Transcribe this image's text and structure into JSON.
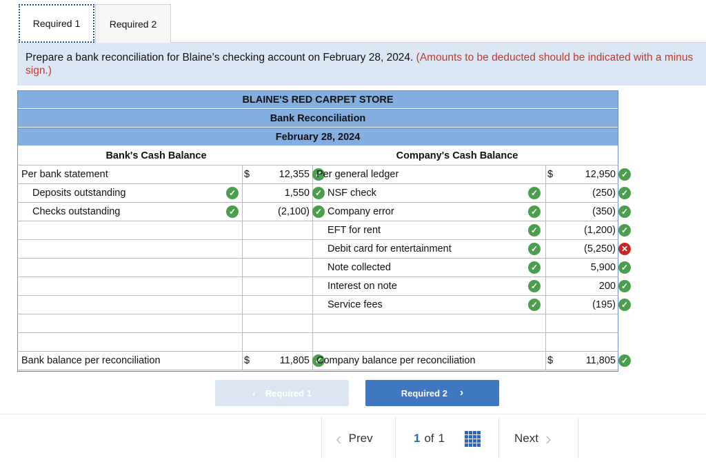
{
  "tabs": [
    {
      "label": "Required 1"
    },
    {
      "label": "Required 2"
    }
  ],
  "instruction": {
    "text": "Prepare a bank reconciliation for Blaine’s checking account on February 28, 2024.",
    "note": "(Amounts to be deducted should be indicated with a minus sign.)"
  },
  "report": {
    "company": "BLAINE'S RED CARPET STORE",
    "title": "Bank Reconciliation",
    "date": "February 28, 2024",
    "bank_header": "Bank's Cash Balance",
    "company_header": "Company's Cash Balance",
    "bank_rows": [
      {
        "label": "Per bank statement",
        "dollar": "$",
        "amount": "12,355",
        "status": "correct",
        "label_check": ""
      },
      {
        "label": "Deposits outstanding",
        "dollar": "",
        "amount": "1,550",
        "status": "correct",
        "label_check": "correct"
      },
      {
        "label": "Checks outstanding",
        "dollar": "",
        "amount": "(2,100)",
        "status": "correct",
        "label_check": "correct"
      }
    ],
    "company_rows": [
      {
        "label": "Per general ledger",
        "dollar": "$",
        "amount": "12,950",
        "status": "correct",
        "label_check": ""
      },
      {
        "label": "NSF check",
        "dollar": "",
        "amount": "(250)",
        "status": "correct",
        "label_check": "correct"
      },
      {
        "label": "Company error",
        "dollar": "",
        "amount": "(350)",
        "status": "correct",
        "label_check": "correct"
      },
      {
        "label": "EFT for rent",
        "dollar": "",
        "amount": "(1,200)",
        "status": "correct",
        "label_check": "correct"
      },
      {
        "label": "Debit card for entertainment",
        "dollar": "",
        "amount": "(5,250)",
        "status": "incorrect",
        "label_check": "correct"
      },
      {
        "label": "Note collected",
        "dollar": "",
        "amount": "5,900",
        "status": "correct",
        "label_check": "correct"
      },
      {
        "label": "Interest on note",
        "dollar": "",
        "amount": "200",
        "status": "correct",
        "label_check": "correct"
      },
      {
        "label": "Service fees",
        "dollar": "",
        "amount": "(195)",
        "status": "correct",
        "label_check": "correct"
      }
    ],
    "bank_total": {
      "label": "Bank balance per reconciliation",
      "dollar": "$",
      "amount": "11,805"
    },
    "company_total": {
      "label": "Company balance per reconciliation",
      "dollar": "$",
      "amount": "11,805"
    }
  },
  "buttons": {
    "prev_label": "Required 1",
    "next_label": "Required 2"
  },
  "pager": {
    "prev": "Prev",
    "current": "1",
    "of": "of",
    "total": "1",
    "next": "Next"
  },
  "colors": {
    "header_blue": "#82aee0",
    "check_green": "#4c9e4f",
    "error_red": "#c62828",
    "button_blue": "#3f76c0"
  }
}
